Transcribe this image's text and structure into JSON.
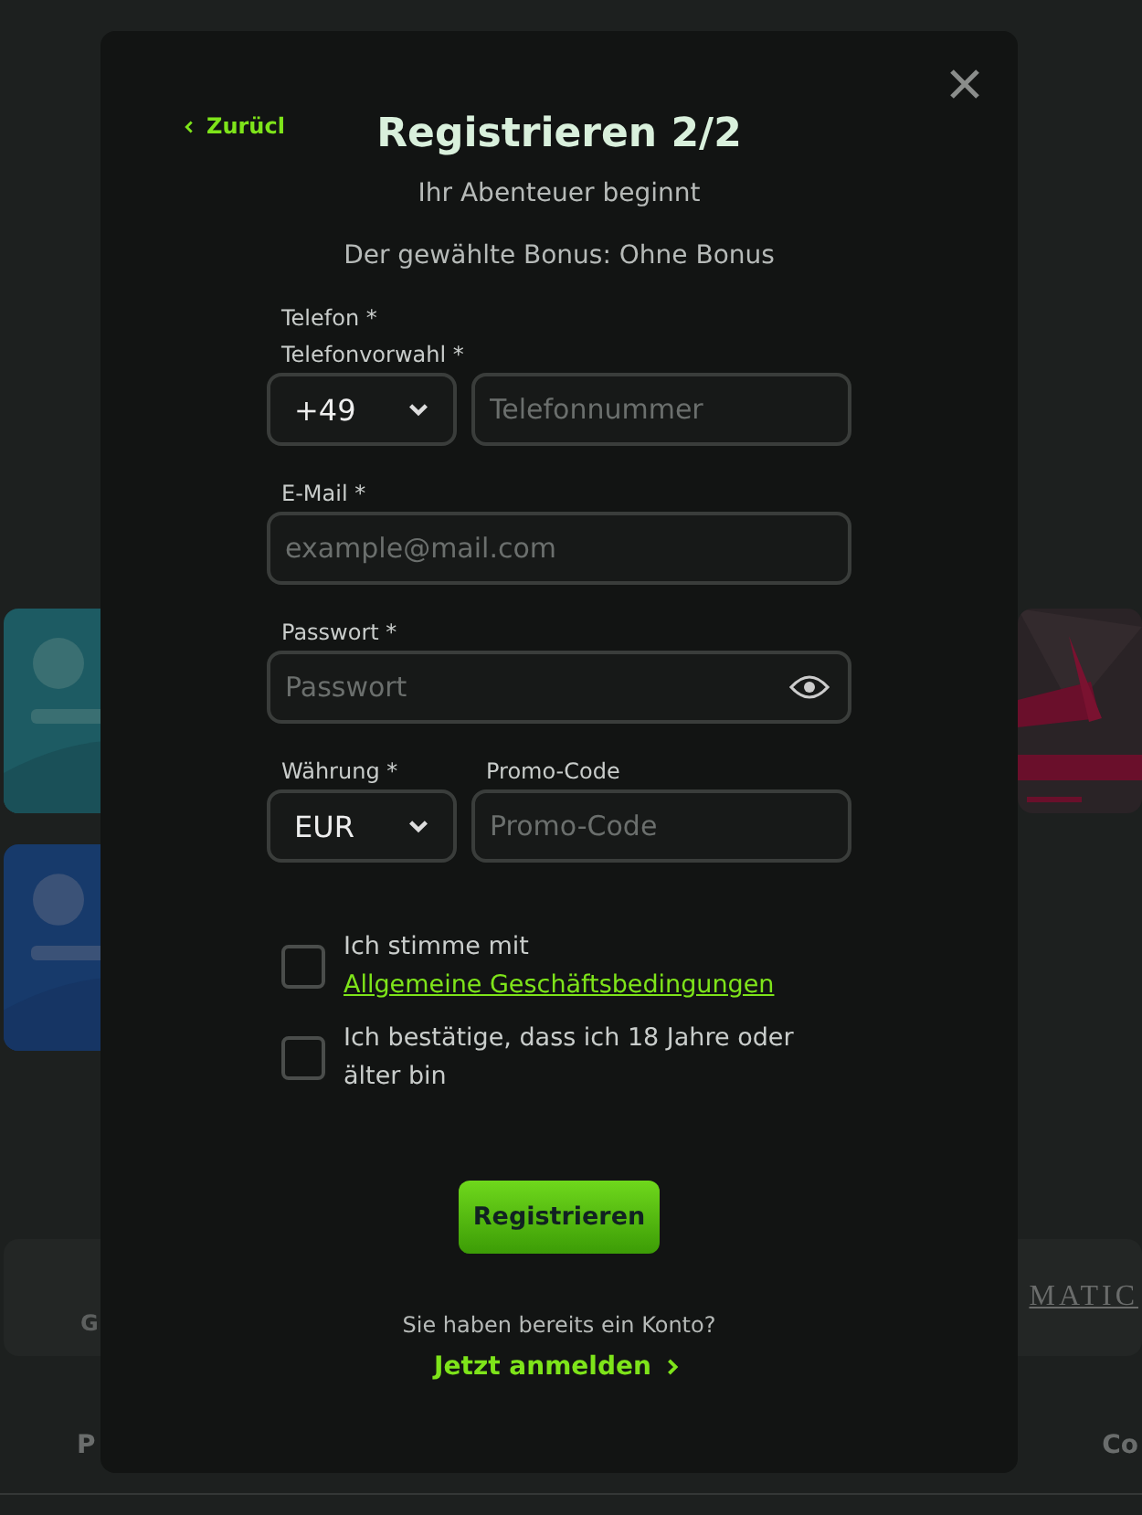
{
  "background": {
    "partner_text": "G",
    "partner_logo": "MATIC",
    "footer_links": [
      "P",
      "Co"
    ]
  },
  "modal": {
    "back_link": "Zurücl",
    "title": "Registrieren 2/2",
    "subtitle": "Ihr Abenteuer beginnt",
    "bonus_text": "Der gewählte Bonus: Ohne Bonus",
    "phone": {
      "label": "Telefon *",
      "prefix_label": "Telefonvorwahl *",
      "prefix": "+49",
      "placeholder": "Telefonnummer"
    },
    "email": {
      "label": "E-Mail *",
      "placeholder": "example@mail.com"
    },
    "password": {
      "label": "Passwort *",
      "placeholder": "Passwort"
    },
    "currency": {
      "label": "Währung *",
      "value": "EUR"
    },
    "promo": {
      "label": "Promo-Code",
      "placeholder": "Promo-Code"
    },
    "checkboxes": [
      {
        "text": "Ich stimme mit ",
        "link": "Allgemeine Geschäftsbedingungen",
        "checked": false
      },
      {
        "text": "Ich bestätige, dass ich 18 Jahre oder älter bin",
        "checked": false
      }
    ],
    "submit": "Registrieren",
    "login_prompt": "Sie haben bereits ein Konto?",
    "login_link": "Jetzt anmelden"
  }
}
